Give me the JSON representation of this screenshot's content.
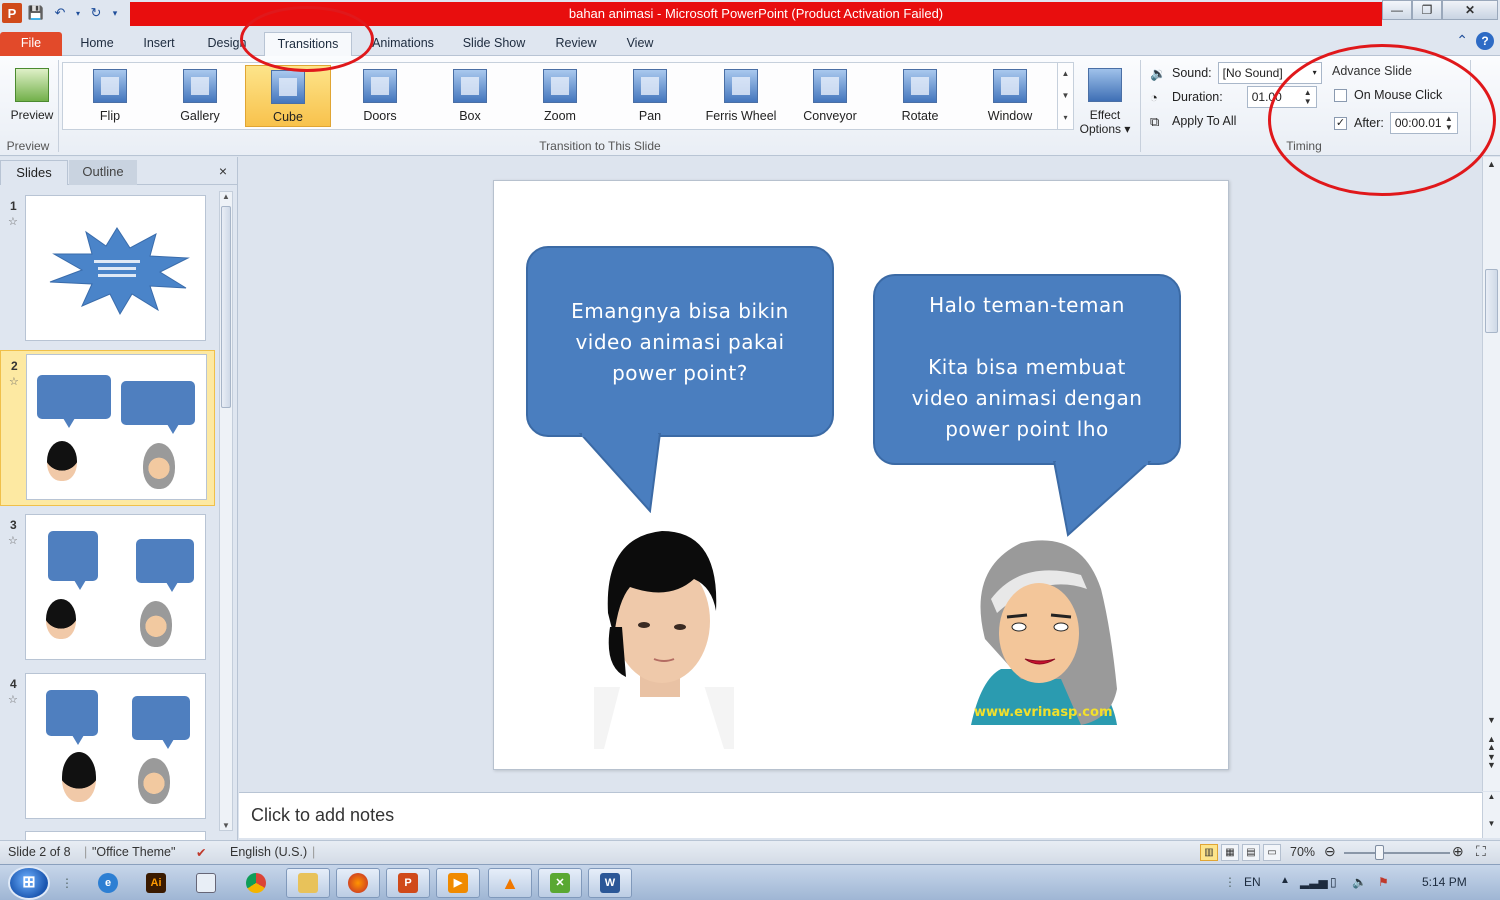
{
  "window": {
    "title": "bahan animasi  -  Microsoft PowerPoint (Product Activation Failed)",
    "app_icon_letter": "P",
    "minimize": "—",
    "restore": "❐",
    "close": "✕"
  },
  "tabs": [
    {
      "label": "File"
    },
    {
      "label": "Home"
    },
    {
      "label": "Insert"
    },
    {
      "label": "Design"
    },
    {
      "label": "Transitions"
    },
    {
      "label": "Animations"
    },
    {
      "label": "Slide Show"
    },
    {
      "label": "Review"
    },
    {
      "label": "View"
    }
  ],
  "ribbon": {
    "preview_label": "Preview",
    "preview_group": "Preview",
    "transition_group": "Transition to This Slide",
    "transitions": [
      {
        "label": "Flip"
      },
      {
        "label": "Gallery"
      },
      {
        "label": "Cube"
      },
      {
        "label": "Doors"
      },
      {
        "label": "Box"
      },
      {
        "label": "Zoom"
      },
      {
        "label": "Pan"
      },
      {
        "label": "Ferris Wheel"
      },
      {
        "label": "Conveyor"
      },
      {
        "label": "Rotate"
      },
      {
        "label": "Window"
      }
    ],
    "selected_transition": "Cube",
    "effect_options_line1": "Effect",
    "effect_options_line2": "Options ▾",
    "sound_label": "Sound:",
    "sound_value": "[No Sound]",
    "duration_label": "Duration:",
    "duration_value": "01.00",
    "apply_to_all": "Apply To All",
    "advance_slide": "Advance Slide",
    "on_mouse_click": "On Mouse Click",
    "on_mouse_click_checked": false,
    "after_label": "After:",
    "after_value": "00:00.01",
    "after_checked": true,
    "timing_group": "Timing"
  },
  "left_pane": {
    "tab_slides": "Slides",
    "tab_outline": "Outline",
    "close": "×",
    "thumbnails": [
      {
        "num": "1"
      },
      {
        "num": "2"
      },
      {
        "num": "3"
      },
      {
        "num": "4"
      }
    ],
    "selected_index": 2
  },
  "slide": {
    "left_bubble": [
      "Emangnya bisa bikin",
      "video animasi pakai",
      "power point?"
    ],
    "right_bubble": [
      "Halo teman-teman",
      "",
      "Kita bisa membuat",
      "video animasi dengan",
      "power point lho"
    ],
    "website": "www.evrinasp.com"
  },
  "notes": {
    "placeholder": "Click to add notes"
  },
  "status": {
    "slide_info": "Slide 2 of 8",
    "theme": "\"Office Theme\"",
    "language": "English (U.S.)",
    "zoom": "70%",
    "zoom_level": 0.35
  },
  "taskbar": {
    "start": "⊞",
    "tray_lang": "EN",
    "time": "5:14 PM"
  },
  "colors": {
    "title_bar_red": "#e80e0e",
    "file_tab": "#e24a2a",
    "bubble_blue": "#4a7ebf",
    "annotation_red": "#e0181b",
    "selection_yellow": "#fde48a"
  }
}
